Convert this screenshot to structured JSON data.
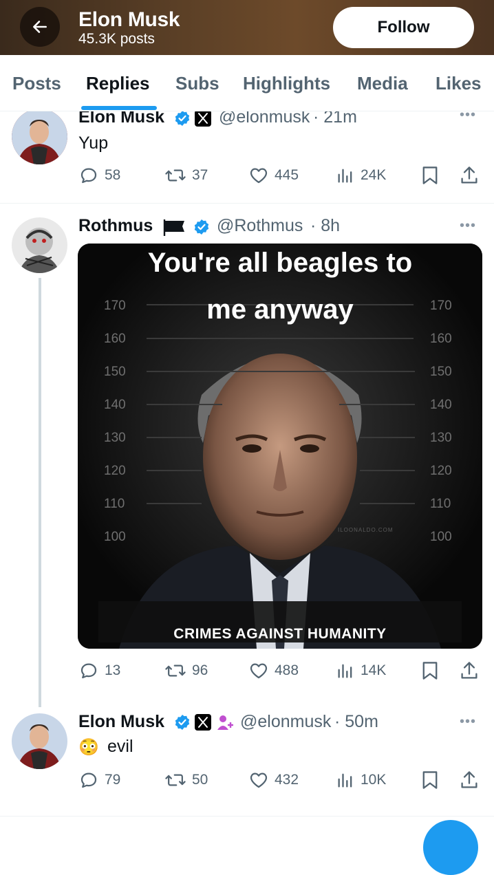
{
  "header": {
    "title": "Elon Musk",
    "subtitle": "45.3K posts",
    "follow_label": "Follow"
  },
  "tabs": [
    {
      "label": "Posts"
    },
    {
      "label": "Replies"
    },
    {
      "label": "Subs"
    },
    {
      "label": "Highlights"
    },
    {
      "label": "Media"
    },
    {
      "label": "Likes"
    }
  ],
  "active_tab": "Replies",
  "posts": [
    {
      "name": "Elon Musk",
      "handle": "@elonmusk",
      "time": "· 21m",
      "text": "Yup",
      "stats": {
        "replies": "58",
        "reposts": "37",
        "likes": "445",
        "views": "24K"
      }
    },
    {
      "name": "Rothmus",
      "handle": "@Rothmus",
      "time": "· 8h",
      "media": {
        "caption_top_1": "You're all beagles to",
        "caption_top_2": "me anyway",
        "caption_bottom": "CRIMES AGAINST HUMANITY",
        "watermark": "ILOONALDO.COM",
        "ruler_left": [
          "170",
          "160",
          "150",
          "140",
          "130",
          "120",
          "110",
          "100"
        ],
        "ruler_right": [
          "170",
          "160",
          "150",
          "140",
          "130",
          "120",
          "110",
          "100"
        ]
      },
      "stats": {
        "replies": "13",
        "reposts": "96",
        "likes": "488",
        "views": "14K"
      }
    },
    {
      "name": "Elon Musk",
      "handle": "@elonmusk",
      "time": "· 50m",
      "emoji": "😳",
      "text": "evil",
      "stats": {
        "replies": "79",
        "reposts": "50",
        "likes": "432",
        "views": "10K"
      }
    }
  ],
  "colors": {
    "accent": "#1d9bf0",
    "verified": "#1d9bf0",
    "secondary_text": "#536471"
  }
}
